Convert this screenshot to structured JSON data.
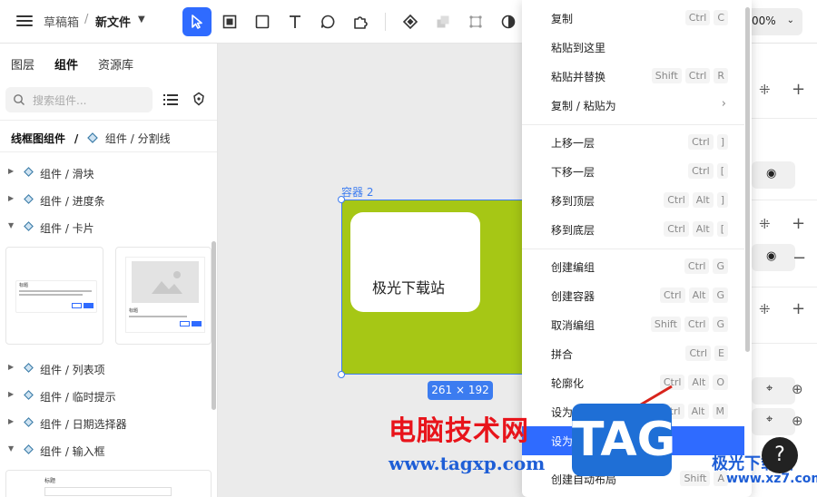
{
  "header": {
    "breadcrumb_draft": "草稿箱",
    "breadcrumb_sep": "/",
    "file_name": "新文件",
    "zoom": "00%"
  },
  "left_panel": {
    "tabs": [
      "图层",
      "组件",
      "资源库"
    ],
    "active_tab": "组件",
    "search_placeholder": "搜索组件...",
    "library_title": "线框图组件",
    "library_sep": "/",
    "library_sub": "组件 / 分割线",
    "tree": [
      {
        "label": "组件 / 滑块",
        "expanded": false
      },
      {
        "label": "组件 / 进度条",
        "expanded": false
      },
      {
        "label": "组件 / 卡片",
        "expanded": true
      },
      {
        "label": "组件 / 列表项",
        "expanded": false
      },
      {
        "label": "组件 / 临时提示",
        "expanded": false
      },
      {
        "label": "组件 / 日期选择器",
        "expanded": false
      },
      {
        "label": "组件 / 输入框",
        "expanded": true
      }
    ],
    "thumb_title_1": "标题",
    "thumb_title_2": "标题",
    "thumb_title_3": "标题"
  },
  "canvas": {
    "container_label": "容器 2",
    "card_text": "极光下载站",
    "size_label": "261 × 192"
  },
  "context_menu": {
    "items": [
      {
        "label": "复制",
        "keys": [
          "Ctrl",
          "C"
        ]
      },
      {
        "label": "粘贴到这里",
        "keys": []
      },
      {
        "label": "粘贴并替换",
        "keys": [
          "Shift",
          "Ctrl",
          "R"
        ]
      },
      {
        "label": "复制 / 粘贴为",
        "keys": [],
        "submenu": true
      },
      {
        "label": "上移一层",
        "keys": [
          "Ctrl",
          "]"
        ]
      },
      {
        "label": "下移一层",
        "keys": [
          "Ctrl",
          "["
        ]
      },
      {
        "label": "移到顶层",
        "keys": [
          "Ctrl",
          "Alt",
          "]"
        ]
      },
      {
        "label": "移到底层",
        "keys": [
          "Ctrl",
          "Alt",
          "["
        ]
      },
      {
        "label": "创建编组",
        "keys": [
          "Ctrl",
          "G"
        ]
      },
      {
        "label": "创建容器",
        "keys": [
          "Ctrl",
          "Alt",
          "G"
        ]
      },
      {
        "label": "取消编组",
        "keys": [
          "Shift",
          "Ctrl",
          "G"
        ]
      },
      {
        "label": "拼合",
        "keys": [
          "Ctrl",
          "E"
        ]
      },
      {
        "label": "轮廓化",
        "keys": [
          "Ctrl",
          "Alt",
          "O"
        ]
      },
      {
        "label": "设为蒙版",
        "keys": [
          "Ctrl",
          "Alt",
          "M"
        ]
      },
      {
        "label": "设为切图",
        "keys": [],
        "highlighted": true
      },
      {
        "label": "创建自动布局",
        "keys": [
          "Shift",
          "A"
        ]
      }
    ]
  },
  "watermark": {
    "cn": "电脑技术网",
    "url": "www.tagxp.com",
    "tag": "TAG",
    "right_cn": "极光下载站",
    "right_url": "www.xz7.com"
  },
  "help_label": "?",
  "colors": {
    "accent": "#2f6bff",
    "canvas_green": "#a6c715",
    "selection": "#3c7cf0"
  }
}
